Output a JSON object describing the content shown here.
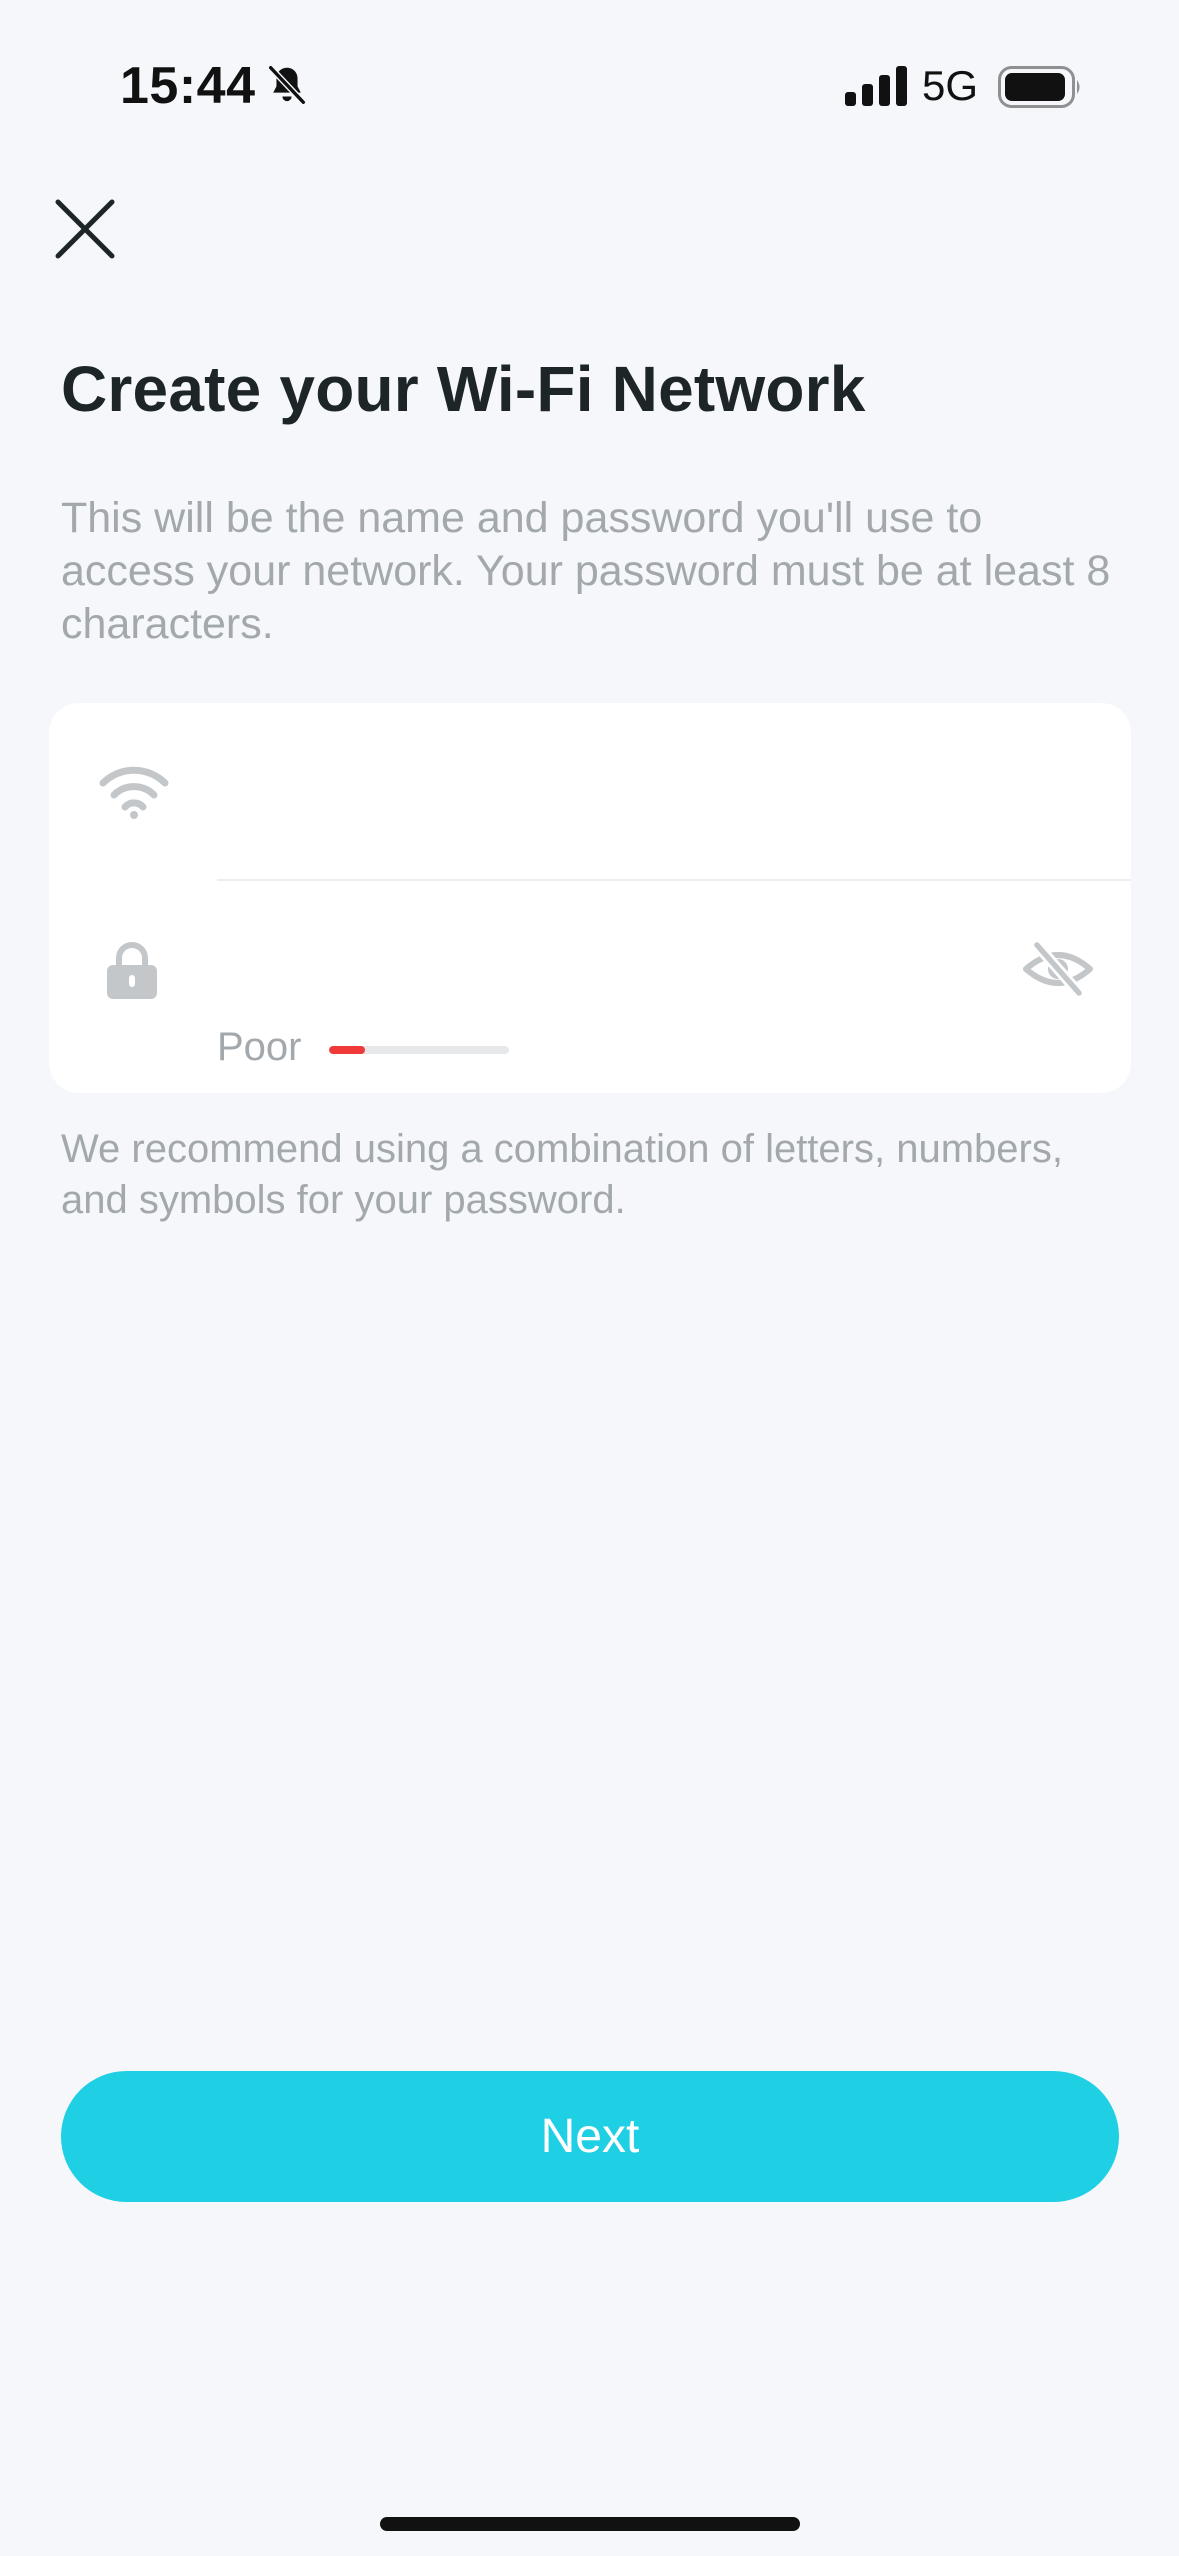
{
  "status_bar": {
    "time": "15:44",
    "network": "5G"
  },
  "page": {
    "title": "Create your Wi-Fi Network",
    "description": "This will be the name and password you'll use to access your network. Your password must be at least 8 characters.",
    "hint": "We recommend using a combination of letters, numbers, and symbols for your password."
  },
  "form": {
    "ssid_value": "",
    "password_value": "",
    "strength_label": "Poor",
    "strength_level": 0.2
  },
  "actions": {
    "next_label": "Next"
  },
  "colors": {
    "accent": "#1fd0e5",
    "strength_poor": "#f03a3a",
    "background": "#f5f7fb"
  }
}
